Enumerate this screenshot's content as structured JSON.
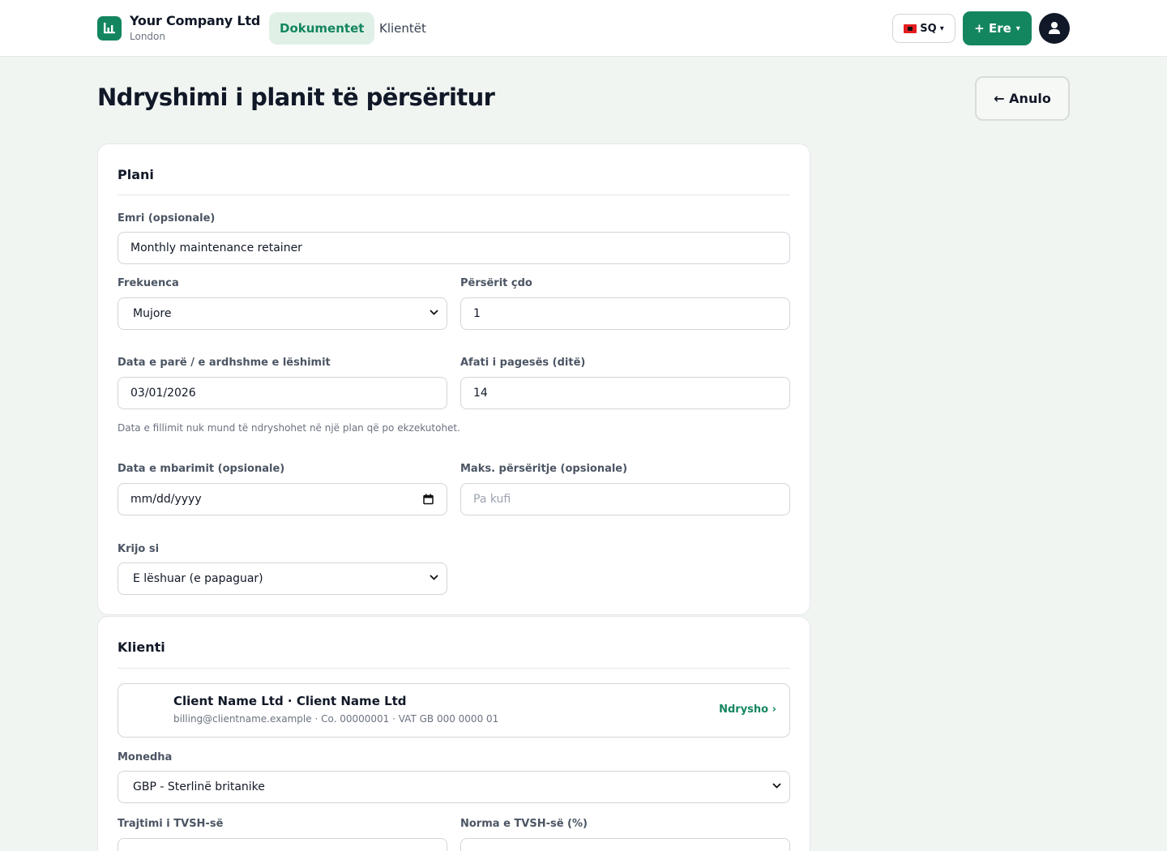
{
  "header": {
    "company_name": "Your Company Ltd",
    "company_city": "London",
    "tabs": [
      {
        "label": "Dokumentet",
        "active": true
      },
      {
        "label": "Klientët",
        "active": false
      }
    ],
    "language": {
      "code": "SQ",
      "caret": "▾"
    },
    "create_button": {
      "label": "+ Ere",
      "caret": "▾"
    },
    "accent_color": "#14865f"
  },
  "page": {
    "title": "Ndryshimi i planit të përsëritur",
    "cancel_label": "← Anulo"
  },
  "plan": {
    "title": "Plani",
    "name": {
      "label": "Emri (opsionale)",
      "value": "Monthly maintenance retainer"
    },
    "frequency": {
      "label": "Frekuenca",
      "value": "Mujore"
    },
    "repeat_every": {
      "label": "Përsërit çdo",
      "value": "1"
    },
    "next_issue_date": {
      "label": "Data e parë / e ardhshme e lëshimit",
      "value": "03/01/2026"
    },
    "payment_terms": {
      "label": "Afati i pagesës (ditë)",
      "value": "14"
    },
    "start_date_help": "Data e fillimit nuk mund të ndryshohet në një plan që po ekzekutohet.",
    "end_date": {
      "label": "Data e mbarimit (opsionale)",
      "placeholder": "mm/dd/yyyy"
    },
    "max_repeats": {
      "label": "Maks. përsëritje (opsionale)",
      "placeholder": "Pa kufi"
    },
    "create_as": {
      "label": "Krijo si",
      "value": "E lëshuar (e papaguar)"
    }
  },
  "client": {
    "title": "Klienti",
    "name": "Client Name Ltd · Client Name Ltd",
    "meta": "billing@clientname.example · Co. 00000001 · VAT GB 000 0000 01",
    "change_label": "Ndrysho ›",
    "currency": {
      "label": "Monedha",
      "value": "GBP - Sterlinë britanike"
    },
    "vat_treatment": {
      "label": "Trajtimi i TVSH-së"
    },
    "vat_rate": {
      "label": "Norma e TVSH-së (%)"
    }
  }
}
